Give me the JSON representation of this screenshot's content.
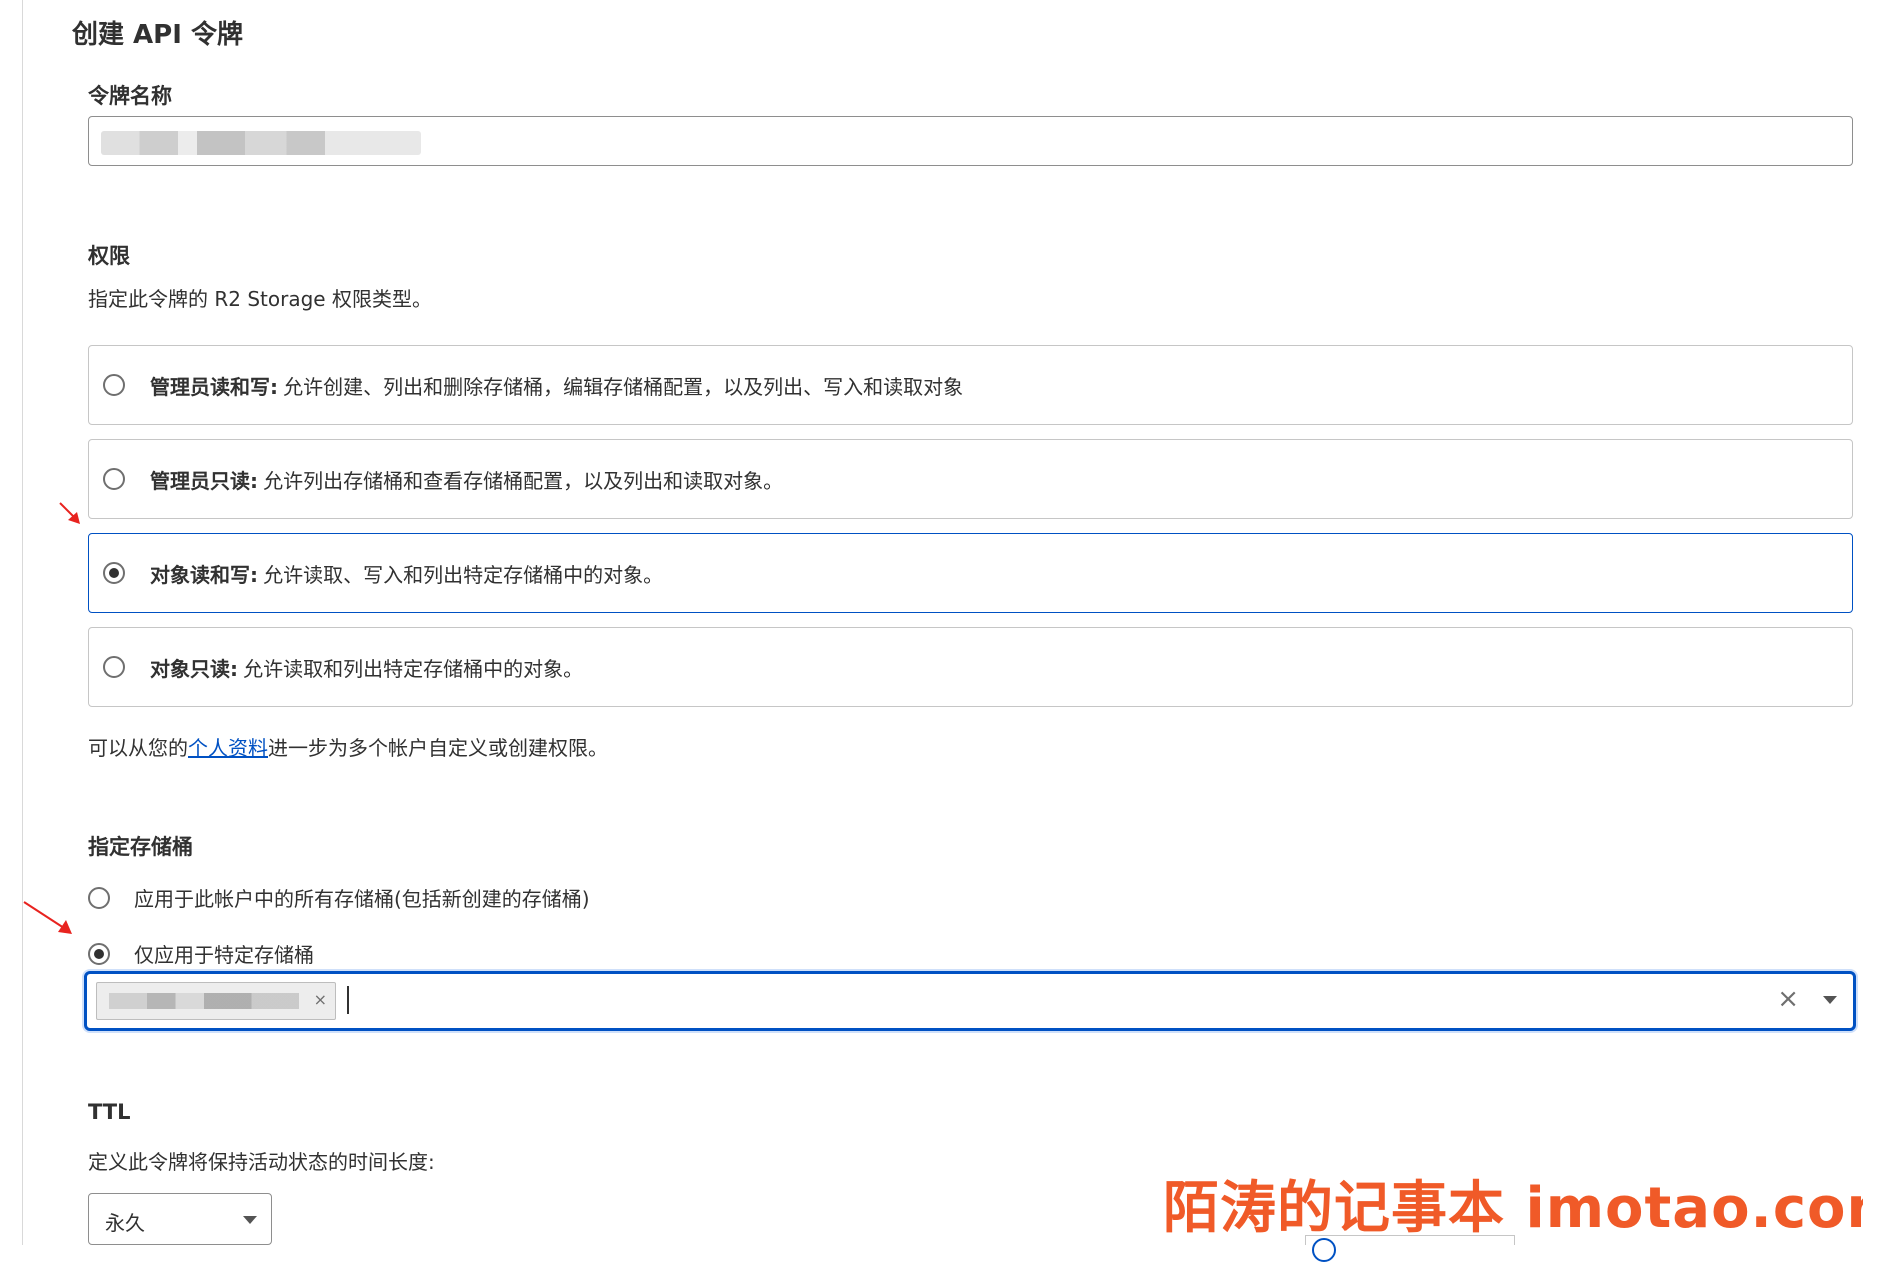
{
  "page": {
    "title": "创建 API 令牌"
  },
  "token_name": {
    "label": "令牌名称",
    "value": ""
  },
  "permissions": {
    "label": "权限",
    "description": "指定此令牌的 R2 Storage 权限类型。",
    "options": [
      {
        "title": "管理员读和写:",
        "desc": "允许创建、列出和删除存储桶，编辑存储桶配置，以及列出、写入和读取对象",
        "selected": false
      },
      {
        "title": "管理员只读:",
        "desc": "允许列出存储桶和查看存储桶配置，以及列出和读取对象。",
        "selected": false
      },
      {
        "title": "对象读和写:",
        "desc": "允许读取、写入和列出特定存储桶中的对象。",
        "selected": true
      },
      {
        "title": "对象只读:",
        "desc": "允许读取和列出特定存储桶中的对象。",
        "selected": false
      }
    ],
    "footer_before": "可以从您的",
    "footer_link": "个人资料",
    "footer_after": "进一步为多个帐户自定义或创建权限。"
  },
  "buckets": {
    "label": "指定存储桶",
    "options": [
      {
        "label": "应用于此帐户中的所有存储桶(包括新创建的存储桶)",
        "selected": false
      },
      {
        "label": "仅应用于特定存储桶",
        "selected": true
      }
    ],
    "chip_remove": "×",
    "clear": "×"
  },
  "ttl": {
    "label": "TTL",
    "description": "定义此令牌将保持活动状态的时间长度:",
    "value": "永久"
  },
  "watermark": "陌涛的记事本 imotao.com",
  "colors": {
    "accent": "#0051c3",
    "annotation_arrow": "#e8231f",
    "watermark": "#f05a28"
  }
}
